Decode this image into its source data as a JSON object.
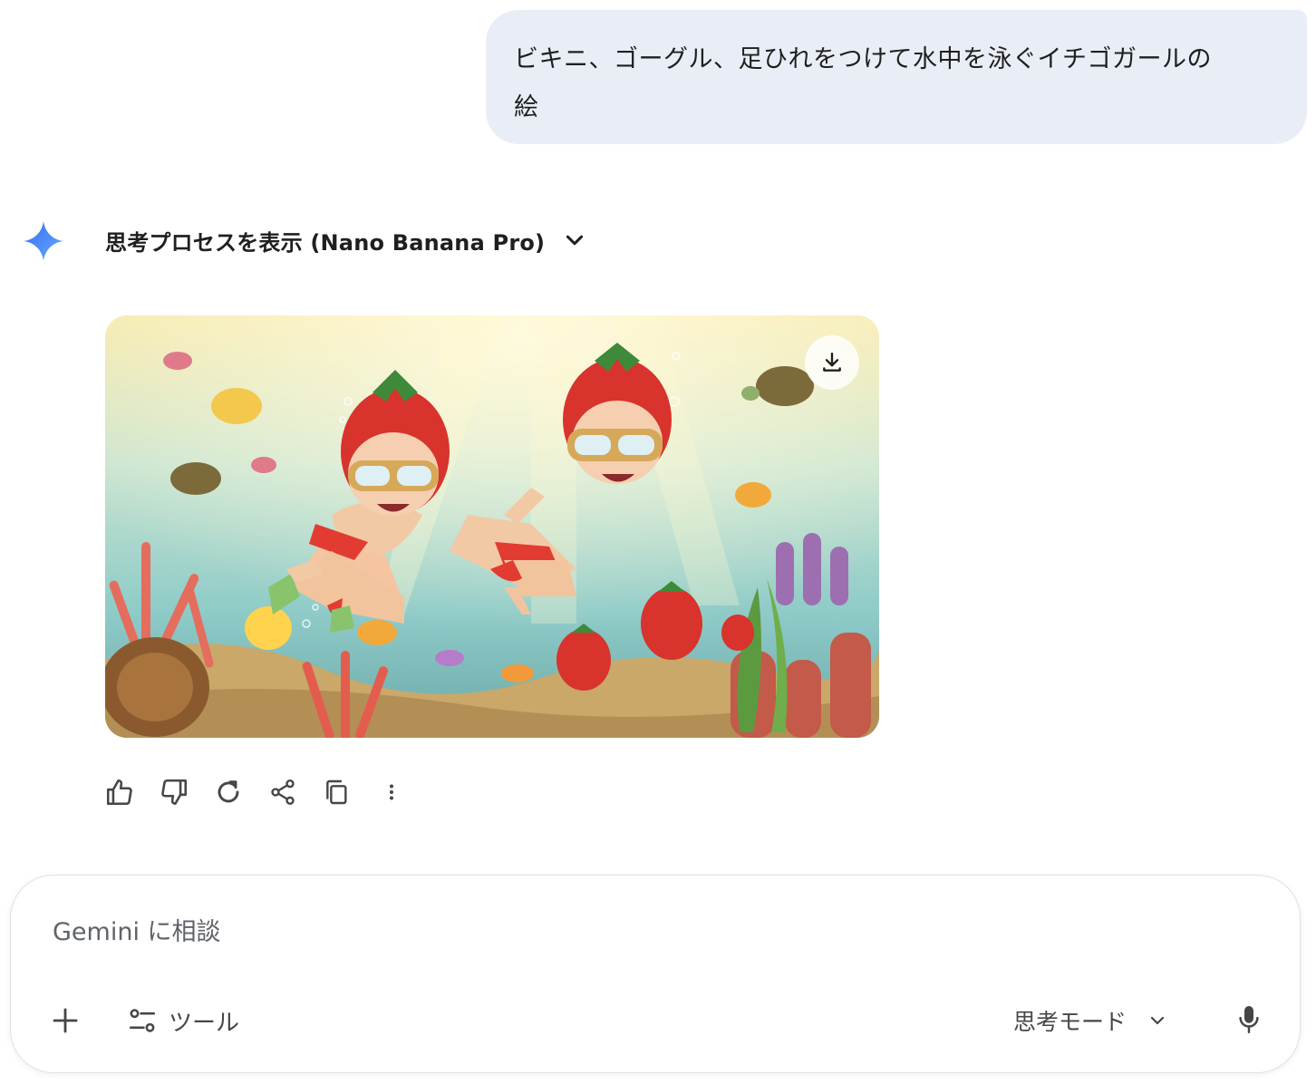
{
  "conversation": {
    "user_message": "ビキニ、ゴーグル、足ひれをつけて水中を泳ぐイチゴガールの\n絵",
    "model": {
      "thinking_toggle_label": "思考プロセスを表示 (Nano Banana Pro)",
      "image_alt": "ビキニ、ゴーグル、足ひれをつけて水中を泳ぐイチゴガールの絵"
    }
  },
  "icons": {
    "model_avatar": "gemini-sparkle-icon",
    "thinking_toggle": "chevron-down-icon",
    "image_download": "download-icon",
    "actions": [
      "thumbs-up-icon",
      "thumbs-down-icon",
      "regenerate-icon",
      "share-icon",
      "copy-icon",
      "more-vert-icon"
    ],
    "composer": [
      "plus-icon",
      "tools-icon",
      "chevron-down-icon",
      "mic-icon"
    ]
  },
  "composer": {
    "placeholder": "Gemini に相談",
    "value": "",
    "tools_label": "ツール",
    "mode_label": "思考モード"
  },
  "colors": {
    "user_bubble_bg": "#e9eef6",
    "gemini_blue": "#4a8cf7",
    "icon_gray": "#444746"
  }
}
